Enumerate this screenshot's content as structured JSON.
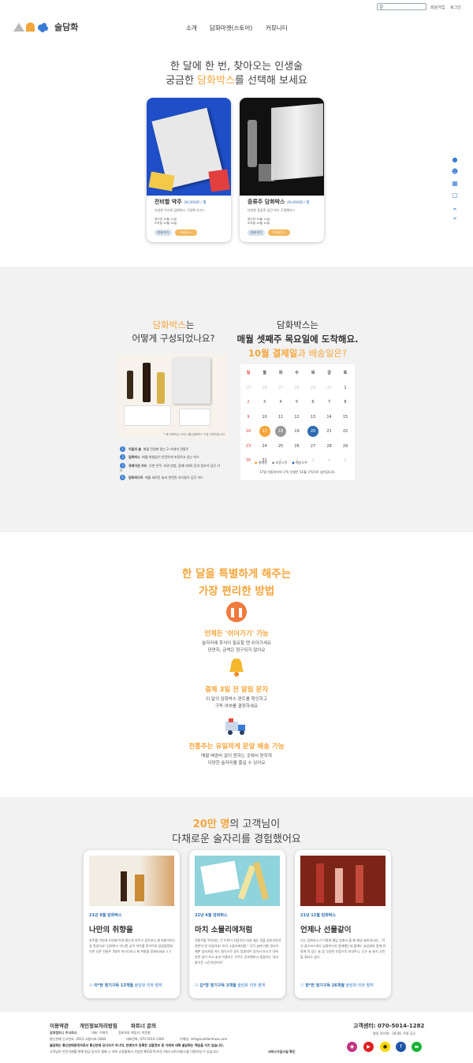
{
  "header": {
    "search": {
      "placeholder": "",
      "icon": "search-icon"
    },
    "links": [
      "회원가입",
      "로그인"
    ],
    "logo_text": "술담화",
    "nav": [
      "소개",
      "담화마켓(스토어)",
      "커뮤니티"
    ]
  },
  "hero": {
    "line1": "한 달에 한 번, 찾아오는 인생술",
    "line2_pre": "궁금한 ",
    "line2_em": "담화박스",
    "line2_post": "를 선택해 보세요",
    "cards": [
      {
        "title": "전비할 약주",
        "price": "39,000원 / 월",
        "desc": "다양한 우리의 담화박스 구경해 가기>",
        "meta1": "정기권 10월 11일",
        "meta2": "도착일 10월 10일",
        "btn1": "판매 보기",
        "btn2": "구독하기 >"
      },
      {
        "title": "증류주 담화박스",
        "price": "49,000원 / 월",
        "desc": "다양한 증류주 담긴 박스 구경해가>",
        "meta1": "정기권 10월 11일",
        "meta2": "도착일 10월 10일",
        "btn1": "판매 보기",
        "btn2": "구독하기 >"
      }
    ]
  },
  "rail": [
    "info-icon",
    "user-icon",
    "calendar-icon",
    "bag-icon",
    "up-icon",
    "down-icon"
  ],
  "composition": {
    "title_em": "담화박스",
    "title_post": "는",
    "title_line2": "어떻게 구성되었나요?",
    "img_caption": "* 위 이미지는 22년 4월 담화박스 구성 이미지입니다.",
    "items": [
      {
        "n": "1",
        "name": "이달의 술",
        "desc": "매월 컨셉에 맞는 2~4개의 전통주"
      },
      {
        "n": "2",
        "name": "담화박스",
        "desc": "매월 위험없이 안전하게 포장하고 있는 박스"
      },
      {
        "n": "3",
        "name": "큐레이션 카드",
        "desc": "추천 안주, 보관 방법, 함께그레의 등의 정보가 담긴 카드"
      },
      {
        "n": "4",
        "name": "담화피디아",
        "desc": "매월 새로운 술과 관련된 지식들이 담긴 카드"
      }
    ]
  },
  "delivery": {
    "line1": "담화박스는",
    "line2": "매월 셋째주 목요일에 도착해요.",
    "line3_em": "10월 결제일",
    "line3_post": "과 배송일은?",
    "weekdays": [
      "일",
      "월",
      "화",
      "수",
      "목",
      "금",
      "토"
    ],
    "weeks": [
      [
        "25",
        "26",
        "27",
        "28",
        "29",
        "30",
        "1"
      ],
      [
        "2",
        "3",
        "4",
        "5",
        "6",
        "7",
        "8"
      ],
      [
        "9",
        "10",
        "11",
        "12",
        "13",
        "14",
        "15"
      ],
      [
        "16",
        "17",
        "18",
        "19",
        "20",
        "21",
        "22"
      ],
      [
        "23",
        "24",
        "25",
        "26",
        "27",
        "28",
        "29"
      ],
      [
        "30",
        "31",
        "1",
        "2",
        "3",
        "4",
        "5"
      ]
    ],
    "legend": [
      "결제일",
      "포장시작",
      "배송도착"
    ],
    "note": "17일 자동부터의 구독 신청은 11월 구독으로 넘어갑니다."
  },
  "features": {
    "title1": "한 달을 특별하게 해주는",
    "title2": "가장 편리한 방법",
    "items": [
      {
        "icon": "pause-icon",
        "title": "언제든 '쉬어가기' 가능",
        "d1": "술자리에 휴식이 필요할 땐 쉬어가세요",
        "d2": "당연히, 금액은 청구되지 않아요"
      },
      {
        "icon": "bell-icon",
        "title": "결제 3일 전 알림 문자",
        "d1": "이 달의 담화박스 판트를 확인하고",
        "d2": "구독 여부를 결정하세요"
      },
      {
        "icon": "truck-icon",
        "title": "전통주는 유일하게 문앞 배송 가능",
        "d1": "매월 배송비 없이 원하는 곳에서 편하게",
        "d2": "다양한 술자리를 즐길 수 있어요"
      }
    ]
  },
  "reviews": {
    "title_em": "20만 명",
    "title_post": "의 고객님이",
    "title_line2": "다채로운 술자리를 경험했어요",
    "cards": [
      {
        "tag": "21년 9월 담화박스",
        "heading": "나만의 취향을",
        "text": "약주를 이번에 두번째 먹게 됐는데 약주가 생각보다 제 취향이라는걸 알았어요! 담화박스 아니면 굳이 약주를 찾아먹지 않았을텐데 이번 다른 전통주 3병이 마시다보니 제 취향을 알게되네요 ㅎㅎ",
        "author": "이*현 정기구독 13개월",
        "link": "술담화 리뷰 팔찌"
      },
      {
        "tag": "22년 4월 담화박스",
        "heading": "마치 소믈리에처럼",
        "text": "전통주를 먹어보는 건 이번이 처음이라 마실 때도 맛을 음미하면서 천천히 맛 보았어요! 마치 소믈리에처럼 ! 각각 술에 대한 정보가 예쁜 엽서처럼 카드 형식으로 같이 동봉되어 있어서 마시기 전에 한번 읽어 보고 술과 어울리는 안주도 준비해보고 좋을려는 내내 즐거운 시간이었어요!",
        "author": "김*형 정기구독 3개월",
        "link": "술담화 리뷰 팔찌"
      },
      {
        "tag": "21년 12월 담화박스",
        "heading": "언제나 선물같이",
        "text": "나는 담화박스가 이렇게 예감 맞춰서 올 때 제일 짜릿하더라... 작년 클스마스에도 담화박스와 함께했는데 올해도 술담화와 함께 연말에 먹 있는 술 류 다양한 조합으로 보내주니, 무슨 술 살지 고민할 필요도 없다.",
        "author": "정*한 정기구독 26개월",
        "link": "술담화 리뷰 팔찌"
      }
    ]
  },
  "footer": {
    "links": [
      "이용약관",
      "개인정보처리방침",
      "파트너 문의"
    ],
    "company": "담화컴퍼니 주식회사",
    "ceo": "대표: 이재욱",
    "privacy": "정보보호 책임자: 박준형",
    "reg": "통신판매 신고번호: 2021-서울서초-2084",
    "phone_line": "대표전화: 070-5014-1282",
    "email": "이메일: info@sooldamhwa.com",
    "disclaimer1": "술담화는 통신판매중개자로서 통신판매 당사자가 아니며, 판매자가 등록한 상품정보 및 거래에 대해 술담화는 책임을 지지 않습니다.",
    "disclaimer2": "고객님의 안전거래를 위해 현금 등으로 결제 시 저희 쇼핑몰에서 가입한 NICE(주)이진 (에스크로)서비스를 이용하실 수 있습니다.",
    "escrow": "서비스가입사실 확인",
    "cs_label": "고객센터: 070-5014-1282",
    "hours": "평일 10:00 - 18:00, 주말 휴무",
    "sns": [
      "instagram-icon",
      "youtube-icon",
      "kakao-icon",
      "facebook-icon",
      "naver-icon"
    ]
  },
  "colors": {
    "accent": "#f5a53a",
    "blue": "#2c6cb0",
    "gray_bg": "#f2f2f2"
  }
}
